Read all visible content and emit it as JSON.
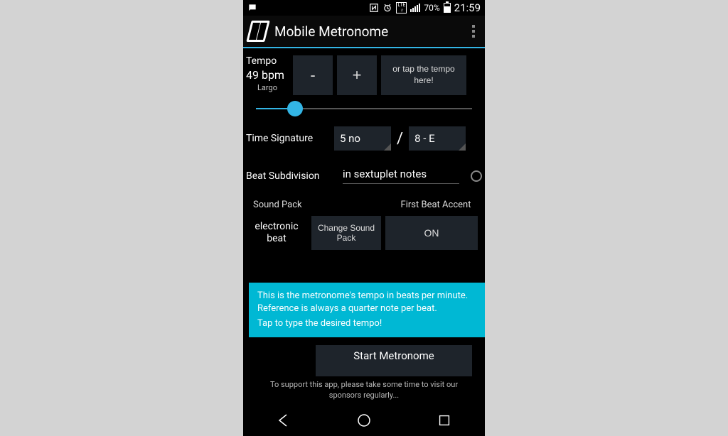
{
  "statusbar": {
    "battery_pct": "70%",
    "clock": "21:59",
    "lte": "LTE"
  },
  "actionbar": {
    "title": "Mobile Metronome"
  },
  "tempo": {
    "label": "Tempo",
    "bpm": "49 bpm",
    "name": "Largo",
    "minus": "-",
    "plus": "+",
    "tap_hint": "or tap the tempo here!"
  },
  "time_signature": {
    "label": "Time Signature",
    "numerator": "5   no",
    "slash": "/",
    "denominator": "8  -  E"
  },
  "beat_subdivision": {
    "label": "Beat Subdivision",
    "value": "in sextuplet notes"
  },
  "sound_pack": {
    "header": "Sound Pack",
    "name": "electronic beat",
    "change_label": "Change Sound Pack"
  },
  "first_beat_accent": {
    "header": "First Beat Accent",
    "value": "ON"
  },
  "tooltip": {
    "line1": "This is the metronome's tempo in beats per minute. Reference is always a quarter note per beat.",
    "line2": "Tap to type the desired tempo!"
  },
  "start_button": "Start Metronome",
  "sponsor_text": "To support this app, please take some time to visit our sponsors regularly..."
}
